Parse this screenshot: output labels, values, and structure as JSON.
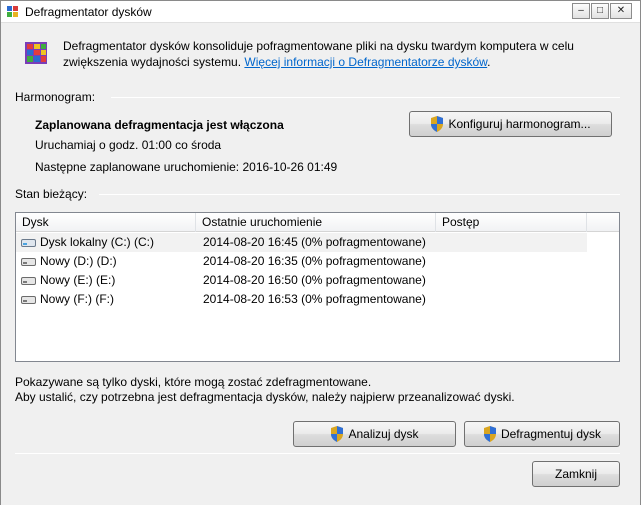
{
  "window": {
    "title": "Defragmentator dysków",
    "minimize_label": "–",
    "maximize_label": "□",
    "close_label": "✕"
  },
  "intro": {
    "text": "Defragmentator dysków konsoliduje pofragmentowane pliki na dysku twardym komputera w celu zwiększenia wydajności systemu. ",
    "link": "Więcej informacji o Defragmentatorze dysków",
    "suffix": "."
  },
  "schedule": {
    "section_label": "Harmonogram:",
    "status": "Zaplanowana defragmentacja jest włączona",
    "run_at": "Uruchamiaj o godz. 01:00 co środa",
    "next_run": "Następne zaplanowane uruchomienie: 2016-10-26 01:49",
    "configure_button": "Konfiguruj harmonogram..."
  },
  "current_state": {
    "section_label": "Stan bieżący:",
    "columns": [
      "Dysk",
      "Ostatnie uruchomienie",
      "Postęp"
    ],
    "rows": [
      {
        "disk": "Dysk lokalny (C:) (C:)",
        "last_run": "2014-08-20 16:45 (0% pofragmentowane)",
        "progress": ""
      },
      {
        "disk": "Nowy (D:) (D:)",
        "last_run": "2014-08-20 16:35 (0% pofragmentowane)",
        "progress": ""
      },
      {
        "disk": "Nowy (E:) (E:)",
        "last_run": "2014-08-20 16:50 (0% pofragmentowane)",
        "progress": ""
      },
      {
        "disk": "Nowy (F:) (F:)",
        "last_run": "2014-08-20 16:53 (0% pofragmentowane)",
        "progress": ""
      }
    ]
  },
  "notes": {
    "line1": "Pokazywane są tylko dyski, które mogą zostać zdefragmentowane.",
    "line2": "Aby ustalić, czy potrzebna jest defragmentacja dysków, należy najpierw przeanalizować dyski."
  },
  "actions": {
    "analyze_button": "Analizuj dysk",
    "defrag_button": "Defragmentuj dysk",
    "close_button": "Zamknij"
  },
  "colors": {
    "link": "#0066cc",
    "selected_row": "#f2f2f2"
  }
}
